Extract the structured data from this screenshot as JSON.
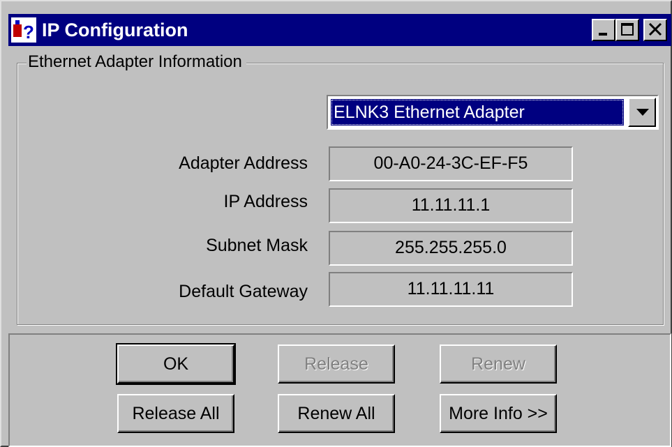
{
  "window": {
    "title": "IP Configuration",
    "icon": "ip-config-icon",
    "controls": {
      "minimize_icon": "minimize-icon",
      "maximize_icon": "maximize-icon",
      "close_icon": "close-icon"
    }
  },
  "adapter_group": {
    "legend": "Ethernet  Adapter Information",
    "selected_adapter": "ELNK3 Ethernet Adapter",
    "dropdown_icon": "chevron-down-icon",
    "fields": [
      {
        "label": "Adapter Address",
        "value": "00-A0-24-3C-EF-F5"
      },
      {
        "label": "IP Address",
        "value": "11.11.11.1"
      },
      {
        "label": "Subnet Mask",
        "value": "255.255.255.0"
      },
      {
        "label": "Default Gateway",
        "value": "11.11.11.11"
      }
    ]
  },
  "buttons": {
    "ok": "OK",
    "release": "Release",
    "renew": "Renew",
    "release_all": "Release All",
    "renew_all": "Renew All",
    "more_info": "More Info >>"
  },
  "colors": {
    "titlebar": "#000080",
    "face": "#c0c0c0",
    "selection": "#000080",
    "disabled_text": "#808080"
  }
}
